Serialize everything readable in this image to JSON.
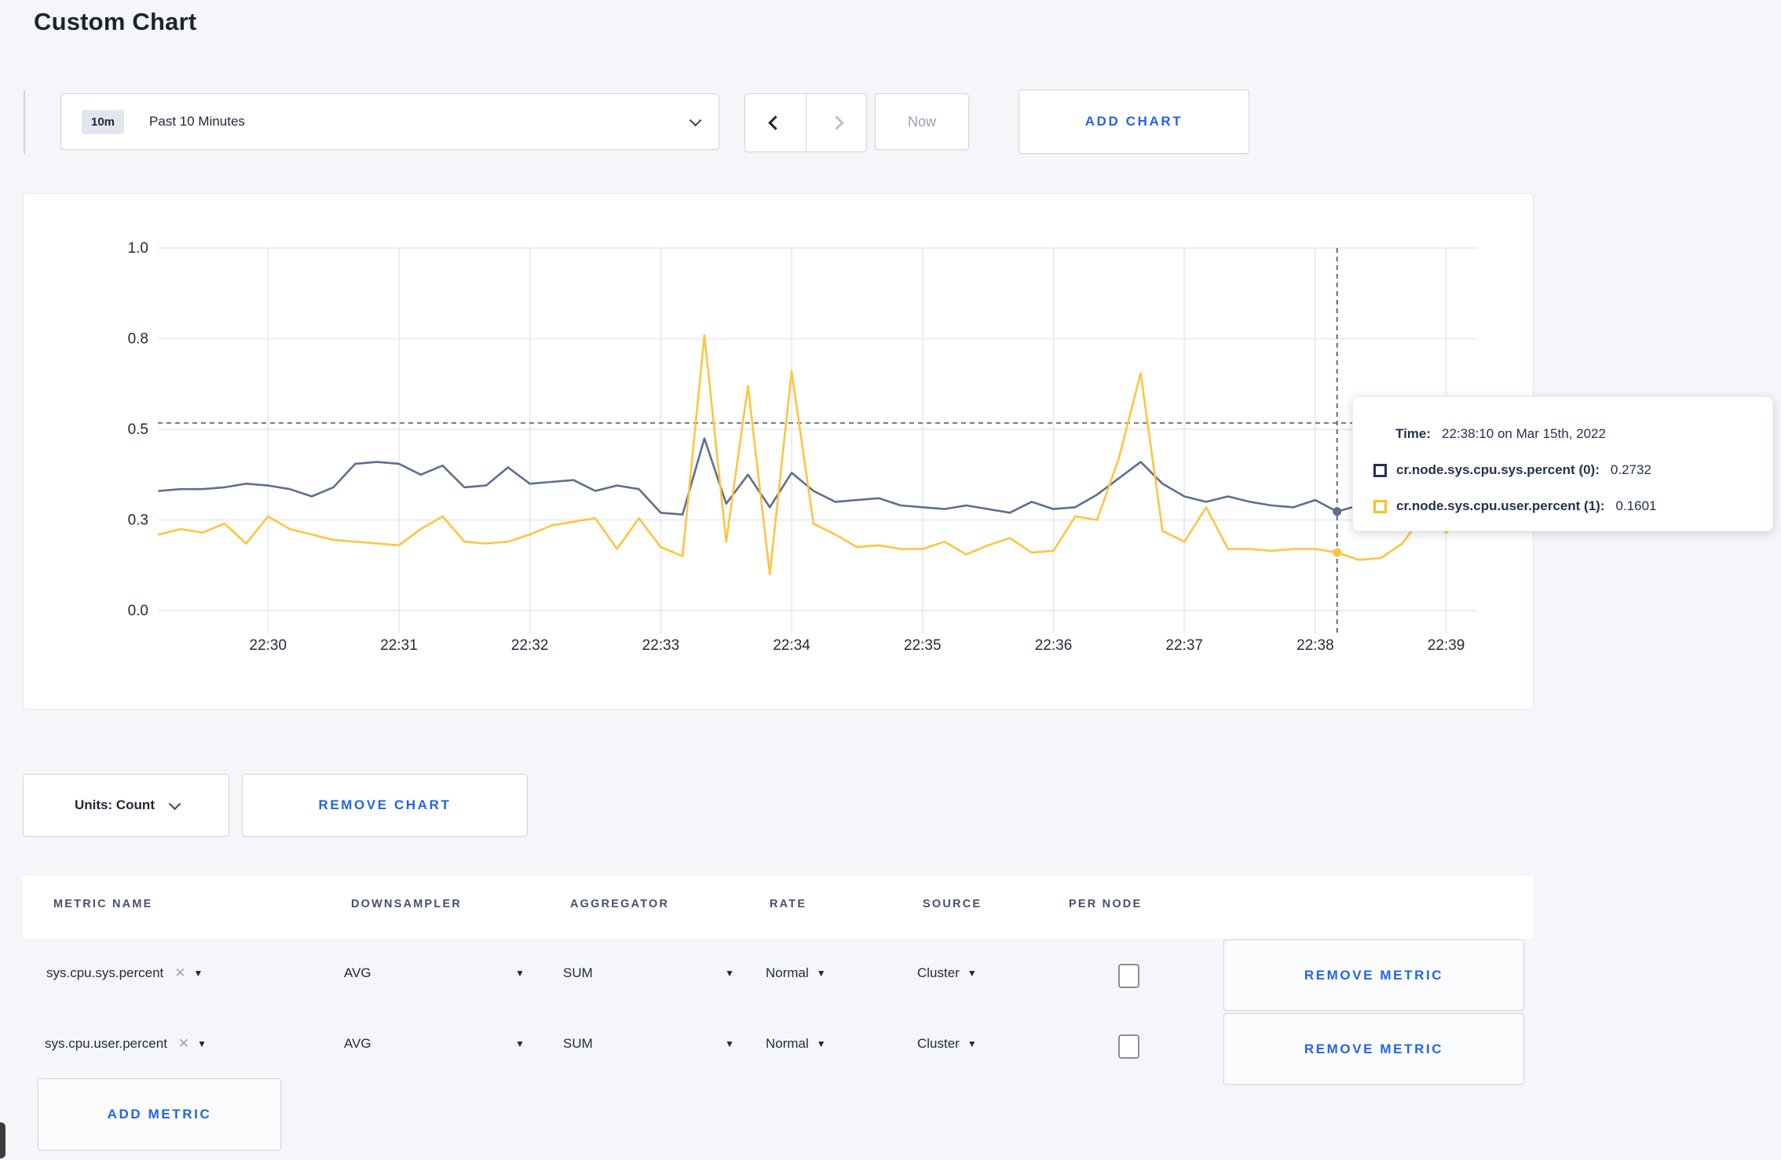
{
  "page": {
    "title": "Custom Chart"
  },
  "icons": {
    "caret_down": "▼",
    "close": "✕"
  },
  "toolbar": {
    "time_badge": "10m",
    "time_label": "Past 10 Minutes",
    "now_label": "Now",
    "add_chart_label": "ADD CHART"
  },
  "chart": {
    "tooltip": {
      "time_label": "Time:",
      "time_value": "22:38:10 on Mar 15th, 2022",
      "series": [
        {
          "label": "cr.node.sys.cpu.sys.percent (0):",
          "value": "0.2732",
          "color": "#22335a"
        },
        {
          "label": "cr.node.sys.cpu.user.percent (1):",
          "value": "0.1601",
          "color": "#f7c325"
        }
      ]
    }
  },
  "chart_data": {
    "type": "line",
    "title": "",
    "x_start": "22:29:10",
    "x_interval_seconds": 10,
    "x_ticks": [
      "22:30",
      "22:31",
      "22:32",
      "22:33",
      "22:34",
      "22:35",
      "22:36",
      "22:37",
      "22:38",
      "22:39"
    ],
    "y_tick_labels": [
      "0.0",
      "0.3",
      "0.5",
      "0.8",
      "1.0"
    ],
    "y_tick_values": [
      0,
      0.25,
      0.5,
      0.75,
      1.0
    ],
    "ylim": [
      0,
      1
    ],
    "grid": true,
    "series": [
      {
        "name": "cr.node.sys.cpu.sys.percent",
        "color": "#5d6f8f",
        "values": [
          0.33,
          0.335,
          0.335,
          0.34,
          0.35,
          0.345,
          0.335,
          0.315,
          0.34,
          0.405,
          0.41,
          0.405,
          0.375,
          0.4,
          0.34,
          0.345,
          0.395,
          0.35,
          0.355,
          0.36,
          0.33,
          0.345,
          0.335,
          0.27,
          0.265,
          0.475,
          0.295,
          0.375,
          0.285,
          0.38,
          0.33,
          0.3,
          0.305,
          0.31,
          0.29,
          0.285,
          0.28,
          0.29,
          0.28,
          0.27,
          0.3,
          0.28,
          0.285,
          0.32,
          0.365,
          0.41,
          0.35,
          0.315,
          0.3,
          0.315,
          0.3,
          0.29,
          0.285,
          0.305,
          0.2732,
          0.29,
          0.3,
          0.31,
          0.3,
          0.305,
          0.31
        ]
      },
      {
        "name": "cr.node.sys.cpu.user.percent",
        "color": "#fdc53f",
        "values": [
          0.21,
          0.225,
          0.215,
          0.24,
          0.185,
          0.26,
          0.225,
          0.21,
          0.195,
          0.19,
          0.185,
          0.18,
          0.225,
          0.26,
          0.19,
          0.185,
          0.19,
          0.21,
          0.235,
          0.245,
          0.255,
          0.17,
          0.255,
          0.175,
          0.15,
          0.76,
          0.19,
          0.62,
          0.1,
          0.66,
          0.24,
          0.21,
          0.175,
          0.18,
          0.17,
          0.17,
          0.19,
          0.155,
          0.18,
          0.2,
          0.16,
          0.165,
          0.26,
          0.25,
          0.42,
          0.655,
          0.22,
          0.19,
          0.285,
          0.17,
          0.17,
          0.165,
          0.17,
          0.17,
          0.1601,
          0.14,
          0.145,
          0.185,
          0.27,
          0.215,
          0.265
        ]
      }
    ],
    "crosshair": {
      "time": "22:38:10",
      "x_index": 54,
      "hline_value": 0.5175,
      "points": [
        {
          "series": 0,
          "value": 0.2732
        },
        {
          "series": 1,
          "value": 0.1601
        }
      ]
    }
  },
  "units": {
    "label": "Units: Count",
    "remove_chart_label": "REMOVE CHART"
  },
  "metrics": {
    "headers": [
      "METRIC NAME",
      "DOWNSAMPLER",
      "AGGREGATOR",
      "RATE",
      "SOURCE",
      "PER NODE"
    ],
    "rows": [
      {
        "name": "sys.cpu.sys.percent",
        "downsampler": "AVG",
        "aggregator": "SUM",
        "rate": "Normal",
        "source": "Cluster",
        "per_node": false,
        "remove_label": "REMOVE METRIC"
      },
      {
        "name": "sys.cpu.user.percent",
        "downsampler": "AVG",
        "aggregator": "SUM",
        "rate": "Normal",
        "source": "Cluster",
        "per_node": false,
        "remove_label": "REMOVE METRIC"
      }
    ],
    "add_metric_label": "ADD METRIC"
  }
}
